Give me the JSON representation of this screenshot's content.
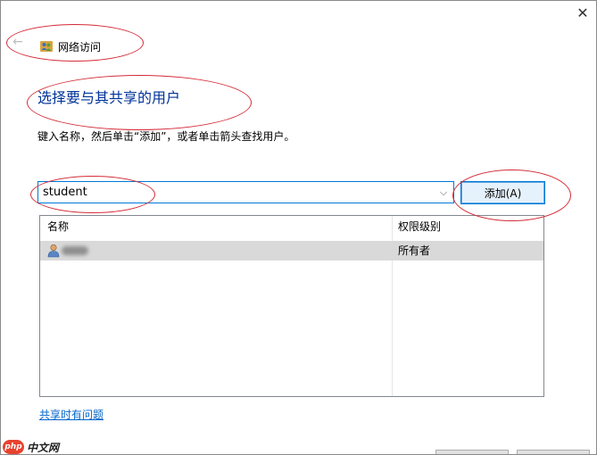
{
  "window": {
    "close_glyph": "✕"
  },
  "header": {
    "back_glyph": "←",
    "title": "网络访问",
    "app_icon": "network-users-icon"
  },
  "main": {
    "heading": "选择要与其共享的用户",
    "instruction": "键入名称，然后单击“添加”，或者单击箭头查找用户。"
  },
  "user_combo": {
    "value": "student",
    "arrow_glyph": "⌵"
  },
  "add_button": {
    "label": "添加(A)"
  },
  "user_list": {
    "columns": [
      "名称",
      "权限级别"
    ],
    "rows": [
      {
        "name": "",
        "name_obscured": true,
        "permission": "所有者"
      }
    ]
  },
  "help_link": {
    "label": "共享时有问题"
  },
  "watermark": {
    "logo_text": "php",
    "text": "中文网"
  },
  "colors": {
    "heading": "#003399",
    "link": "#0066cc",
    "focus_border": "#0078d7",
    "selected_row": "#d9d9d9",
    "annotation": "#d42a36"
  }
}
